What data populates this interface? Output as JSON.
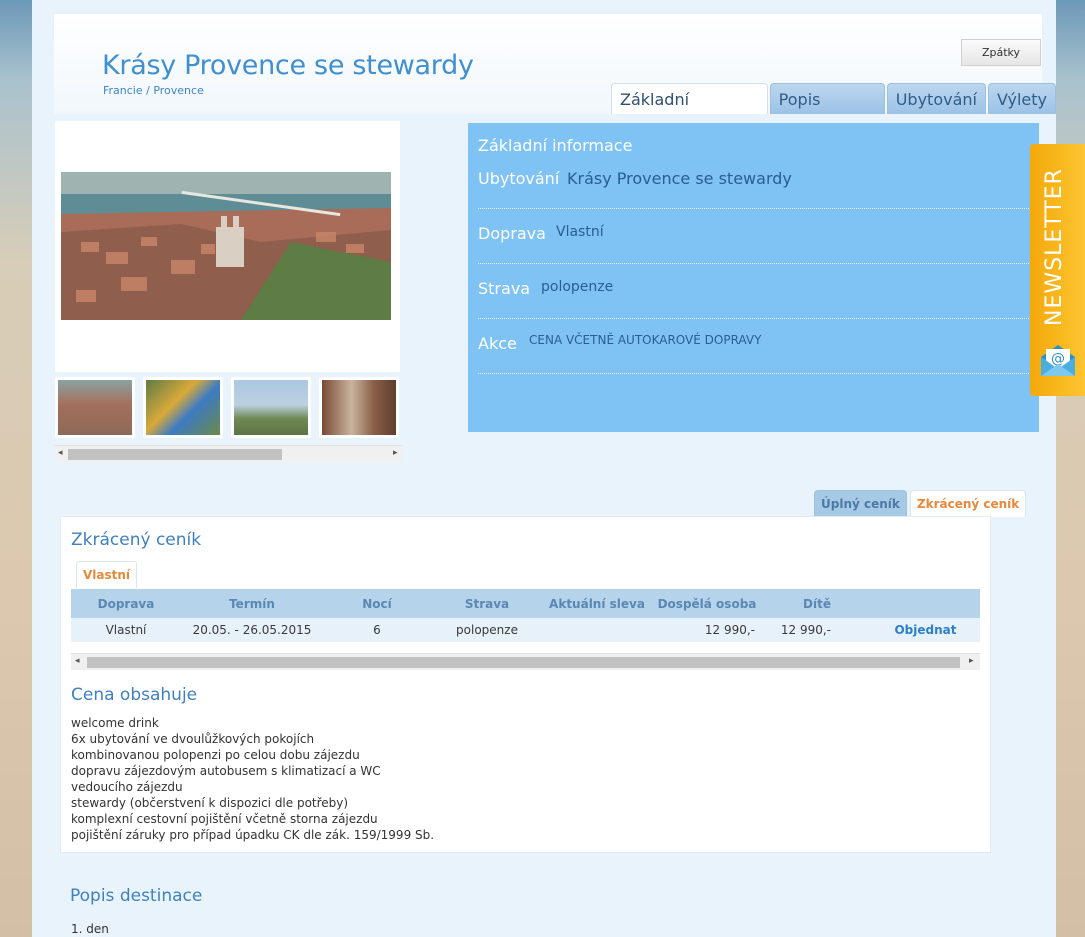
{
  "header": {
    "title": "Krásy Provence se stewardy",
    "breadcrumb": "Francie / Provence",
    "back_label": "Zpátky",
    "tabs": [
      {
        "label": "Základní informace",
        "active": true
      },
      {
        "label": "Popis zájezdu",
        "active": false
      },
      {
        "label": "Ubytování",
        "active": false
      },
      {
        "label": "Výlety",
        "active": false
      }
    ]
  },
  "gallery": {
    "main_image": "city-aerial-photo",
    "thumbnails": [
      "city-aerial-thumb",
      "painting-thumb",
      "bridge-thumb",
      "street-thumb"
    ]
  },
  "info": {
    "title": "Základní informace",
    "rows": [
      {
        "label": "Ubytování",
        "value": "Krásy Provence se stewardy"
      },
      {
        "label": "Doprava",
        "value": "Vlastní"
      },
      {
        "label": "Strava",
        "value": "polopenze"
      },
      {
        "label": "Akce",
        "value": "CENA VČETNĚ AUTOKAROVÉ DOPRAVY"
      }
    ]
  },
  "price": {
    "tabs": [
      {
        "label": "Úplný ceník",
        "active": false
      },
      {
        "label": "Zkrácený ceník",
        "active": true
      }
    ],
    "title": "Zkrácený ceník",
    "subtab": "Vlastní",
    "columns": [
      "Doprava",
      "Termín",
      "Nocí",
      "Strava",
      "Aktuální sleva",
      "Dospělá osoba",
      "Dítě",
      ""
    ],
    "rows": [
      [
        "Vlastní",
        "20.05. - 26.05.2015",
        "6",
        "polopenze",
        "",
        "12 990,-",
        "12 990,-",
        "Objednat"
      ]
    ]
  },
  "includes": {
    "title": "Cena obsahuje",
    "items": [
      "welcome drink",
      "6x ubytování ve dvoulůžkových pokojích",
      "kombinovanou polopenzi po celou dobu zájezdu",
      "dopravu zájezdovým autobusem s klimatizací a WC",
      "vedoucího zájezdu",
      "stewardy (občerstvení k dispozici dle potřeby)",
      "komplexní cestovní pojištění včetně storna zájezdu",
      "pojištění záruky pro případ úpadku CK dle zák. 159/1999 Sb."
    ]
  },
  "description": {
    "title": "Popis destinace",
    "first_line": "1. den"
  },
  "newsletter": {
    "label": "NEWSLETTER",
    "icon": "envelope-at-icon"
  },
  "colors": {
    "accent": "#3f8fd1",
    "info_panel": "#7fc2f4",
    "newsletter": "#f5a80a",
    "orange_tab": "#e7883a"
  }
}
